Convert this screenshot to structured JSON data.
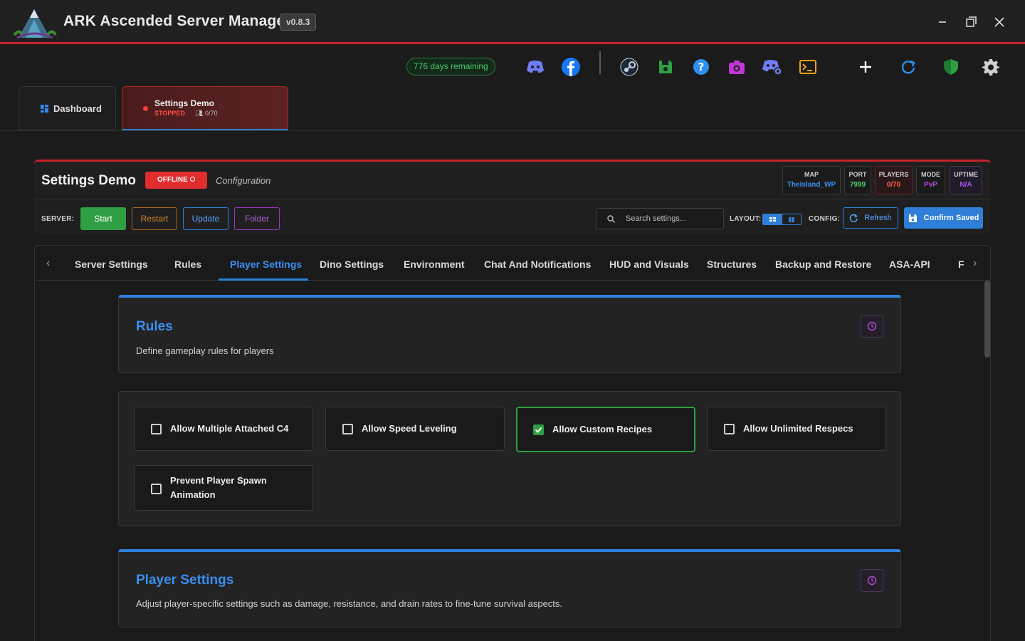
{
  "app": {
    "title": "ARK Ascended Server Manager",
    "version": "v0.8.3"
  },
  "toolbar": {
    "license": "776 days remaining"
  },
  "tabs": {
    "dashboard": "Dashboard",
    "server": {
      "name": "Settings Demo",
      "status": "STOPPED",
      "players": "0/70"
    }
  },
  "server": {
    "title": "Settings Demo",
    "status_badge": "OFFLINE",
    "subtitle": "Configuration",
    "stats": [
      {
        "key": "MAP",
        "value": "TheIsland_WP",
        "color": "#3a8ef0"
      },
      {
        "key": "PORT",
        "value": "7999",
        "color": "#4fc86a"
      },
      {
        "key": "PLAYERS",
        "value": "0/70",
        "color": "#ff5a5a"
      },
      {
        "key": "MODE",
        "value": "PvP",
        "color": "#b04ad8"
      },
      {
        "key": "UPTIME",
        "value": "N/A",
        "color": "#a35ae8"
      }
    ],
    "server_label": "SERVER:",
    "buttons": {
      "start": "Start",
      "restart": "Restart",
      "update": "Update",
      "folder": "Folder"
    },
    "search_placeholder": "Search settings...",
    "layout_label": "LAYOUT:",
    "config_label": "CONFIG:",
    "refresh": "Refresh",
    "confirm": "Confirm Saved"
  },
  "nav": [
    "Server Settings",
    "Rules",
    "Player Settings",
    "Dino Settings",
    "Environment",
    "Chat And Notifications",
    "HUD and Visuals",
    "Structures",
    "Backup and Restore",
    "ASA-API",
    "F"
  ],
  "rules_card": {
    "title": "Rules",
    "desc": "Define gameplay rules for players"
  },
  "options": [
    {
      "label": "Allow Multiple Attached C4",
      "checked": false
    },
    {
      "label": "Allow Speed Leveling",
      "checked": false
    },
    {
      "label": "Allow Custom Recipes",
      "checked": true
    },
    {
      "label": "Allow Unlimited Respecs",
      "checked": false
    },
    {
      "label": "Prevent Player Spawn Animation",
      "checked": false
    }
  ],
  "player_card": {
    "title": "Player Settings",
    "desc": "Adjust player-specific settings such as damage, resistance, and drain rates to fine-tune survival aspects."
  }
}
